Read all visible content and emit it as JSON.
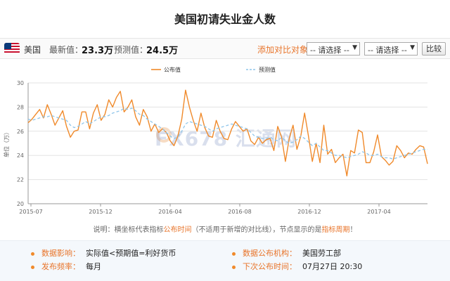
{
  "page": {
    "title": "美国初请失业金人数"
  },
  "info": {
    "country": "美国",
    "latest_label": "最新值：",
    "latest_value": "23.3万",
    "forecast_label": "预测值：",
    "forecast_value": "24.5万",
    "compare_label": "添加对比对象：",
    "select1": "-- 请选择 --",
    "select2": "-- 请选择 --",
    "compare_button": "比较"
  },
  "note": {
    "prefix": "说明：横坐标代表指标",
    "highlight1": "公布时间",
    "middle": "（不适用于新增的对比线），节点显示的是",
    "highlight2": "指标周期",
    "suffix": "！"
  },
  "footer": {
    "impact_label": "数据影响：",
    "impact_value": "实际值<预期值=利好货币",
    "agency_label": "数据公布机构：",
    "agency_value": "美国劳工部",
    "frequency_label": "发布频率：",
    "frequency_value": "每月",
    "next_label": "下次公布时间：",
    "next_value": "07月27日 20:30"
  },
  "watermark": "FX678 汇通网",
  "colors": {
    "actual": "#f08a2b",
    "forecast": "#8ec5ea",
    "accent": "#e8742a",
    "grid": "#e3e3e3"
  },
  "chart_data": {
    "type": "line",
    "ylabel": "单位（万）",
    "ylim": [
      20,
      30
    ],
    "yticks": [
      20,
      22,
      24,
      26,
      28,
      30
    ],
    "x_tick_labels": [
      "2015-07",
      "2015-12",
      "2016-04",
      "2016-08",
      "2016-12",
      "2017-04"
    ],
    "legend": {
      "position": "top-center"
    },
    "series": [
      {
        "name": "公布值",
        "style": "solid",
        "values": [
          26.7,
          27.0,
          27.4,
          27.8,
          27.1,
          28.2,
          27.4,
          26.5,
          27.1,
          27.7,
          26.4,
          25.5,
          26.0,
          26.1,
          27.6,
          27.6,
          26.2,
          27.5,
          28.2,
          26.9,
          27.4,
          28.6,
          28.0,
          28.8,
          29.3,
          27.6,
          28.0,
          28.6,
          27.2,
          26.5,
          27.8,
          27.2,
          26.0,
          26.6,
          25.9,
          26.2,
          25.9,
          25.2,
          24.8,
          25.6,
          27.0,
          29.4,
          28.0,
          26.9,
          26.0,
          27.5,
          26.3,
          25.6,
          25.5,
          26.9,
          26.0,
          25.4,
          25.3,
          26.2,
          26.8,
          26.4,
          26.0,
          26.2,
          25.2,
          24.9,
          25.5,
          25.0,
          25.3,
          25.4,
          24.4,
          26.4,
          25.5,
          23.5,
          25.4,
          26.5,
          24.5,
          25.6,
          27.5,
          25.6,
          23.5,
          25.0,
          23.4,
          26.5,
          24.1,
          24.5,
          23.4,
          23.8,
          24.1,
          22.3,
          24.4,
          24.2,
          26.1,
          25.9,
          23.4,
          23.4,
          24.3,
          25.7,
          23.9,
          23.6,
          23.2,
          23.5,
          24.8,
          24.4,
          23.8,
          24.2,
          24.1,
          24.5,
          24.8,
          24.7,
          23.3
        ]
      },
      {
        "name": "预测值",
        "style": "dashed",
        "values": [
          27.0,
          26.9,
          27.0,
          27.1,
          27.2,
          27.2,
          27.3,
          27.2,
          27.1,
          27.0,
          26.9,
          26.5,
          26.3,
          26.4,
          26.6,
          26.8,
          26.6,
          26.8,
          27.0,
          27.2,
          27.2,
          27.3,
          27.5,
          27.6,
          27.7,
          27.9,
          27.8,
          27.9,
          27.7,
          27.4,
          27.3,
          27.0,
          26.8,
          26.6,
          26.4,
          26.2,
          25.9,
          25.6,
          25.4,
          25.5,
          26.0,
          26.6,
          26.8,
          26.7,
          26.6,
          26.5,
          26.4,
          26.2,
          26.0,
          26.2,
          26.3,
          26.4,
          26.5,
          26.6,
          26.5,
          26.4,
          26.3,
          26.2,
          25.9,
          25.6,
          25.5,
          25.4,
          25.4,
          25.5,
          25.3,
          25.2,
          25.5,
          25.2,
          25.0,
          25.1,
          25.3,
          25.6,
          25.4,
          25.1,
          24.8,
          25.0,
          24.7,
          24.4,
          24.4,
          24.2,
          24.0,
          24.0,
          23.9,
          23.8,
          23.9,
          24.0,
          24.1,
          24.3,
          24.2,
          24.0,
          24.0,
          24.1,
          23.9,
          23.8,
          23.8,
          23.7,
          23.8,
          23.9,
          24.0,
          24.1,
          24.2,
          24.3,
          24.4,
          24.5,
          24.5
        ]
      }
    ]
  }
}
